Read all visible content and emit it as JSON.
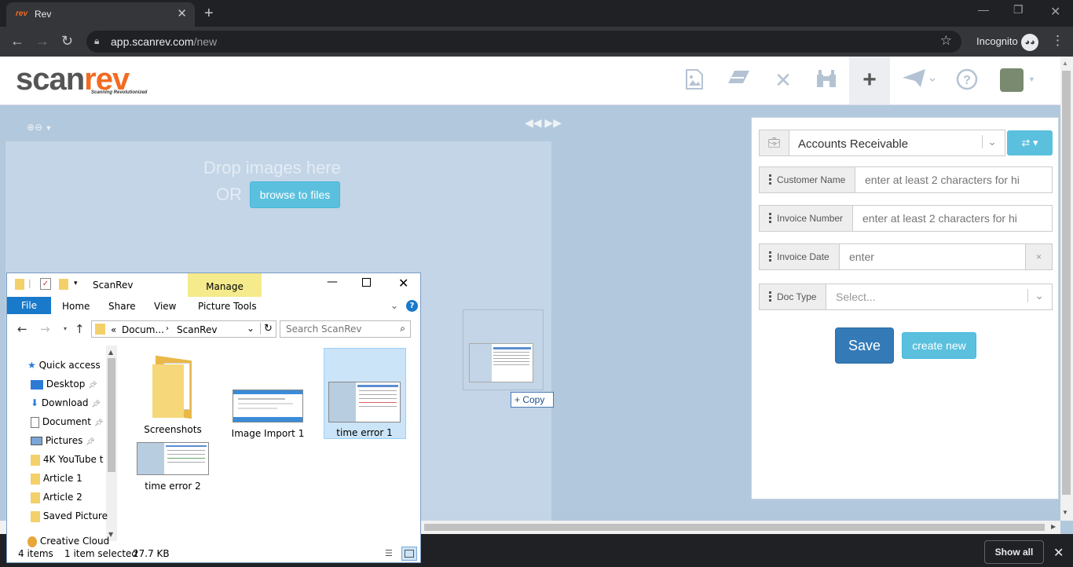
{
  "browser": {
    "tab_favicon": "rev",
    "tab_title": "Rev",
    "url_host": "app.scanrev.com",
    "url_path": "/new",
    "incognito_label": "Incognito"
  },
  "app": {
    "logo_scan": "scan",
    "logo_rev": "rev",
    "tagline": "Scanning Revolutionized",
    "accent_color": "#f26b21",
    "header_icons": [
      "image-icon",
      "eraser-icon",
      "close-icon",
      "binoculars-icon",
      "plus-icon",
      "send-icon",
      "help-icon",
      "avatar"
    ]
  },
  "dropzone": {
    "line1": "Drop images here",
    "line2": "OR",
    "browse_label": "browse to files",
    "copy_tooltip": "+ Copy"
  },
  "form": {
    "department": "Accounts Receivable",
    "fields": [
      {
        "label": "Customer Name",
        "placeholder": "enter at least 2 characters for hi"
      },
      {
        "label": "Invoice Number",
        "placeholder": "enter at least 2 characters for hi"
      },
      {
        "label": "Invoice Date",
        "placeholder": "enter",
        "clear": "×"
      },
      {
        "label": "Doc Type",
        "placeholder": "Select..."
      }
    ],
    "save_label": "Save",
    "create_new_label": "create new"
  },
  "downloads": {
    "show_all": "Show all"
  },
  "explorer": {
    "title": "ScanRev",
    "ribbon_context": "Manage",
    "tabs": [
      "File",
      "Home",
      "Share",
      "View",
      "Picture Tools"
    ],
    "breadcrumb_prefix": "«",
    "breadcrumb": [
      "Docum...",
      "ScanRev"
    ],
    "search_placeholder": "Search ScanRev",
    "nav_items": [
      {
        "label": "Quick access"
      },
      {
        "label": "Desktop"
      },
      {
        "label": "Download"
      },
      {
        "label": "Document"
      },
      {
        "label": "Pictures"
      },
      {
        "label": "4K YouTube t"
      },
      {
        "label": "Article 1"
      },
      {
        "label": "Article 2"
      },
      {
        "label": "Saved Picture"
      },
      {
        "label": "Creative Cloud"
      }
    ],
    "files": [
      {
        "name": "Screenshots"
      },
      {
        "name": "Image Import 1"
      },
      {
        "name": "time error 1"
      },
      {
        "name": "time error 2"
      }
    ],
    "status_count": "4 items",
    "status_selected": "1 item selected",
    "status_size": "27.7 KB"
  }
}
